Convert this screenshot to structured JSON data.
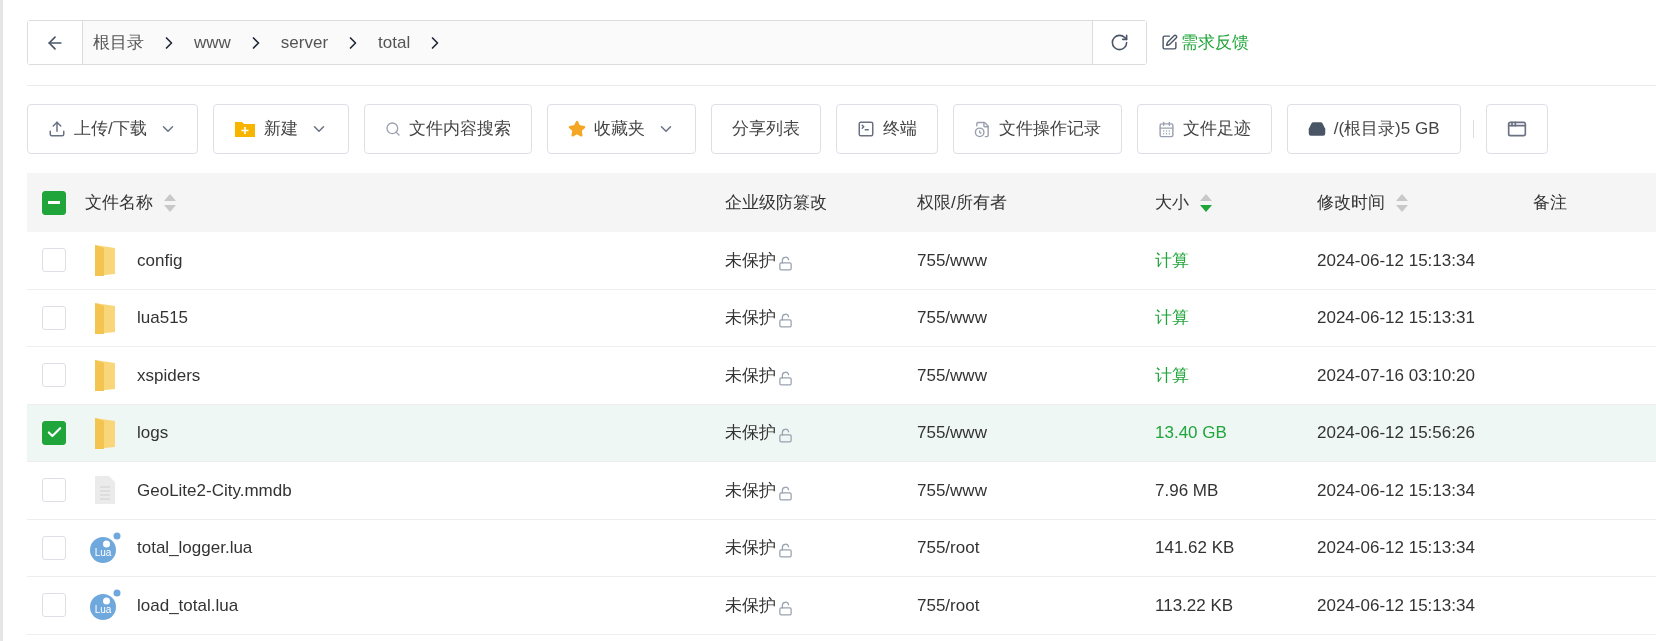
{
  "breadcrumb": {
    "segments": [
      "根目录",
      "www",
      "server",
      "total"
    ]
  },
  "feedback": {
    "label": "需求反馈"
  },
  "toolbar": [
    {
      "label": "上传/下载",
      "kind": "upload",
      "dropdown": true
    },
    {
      "label": "新建",
      "kind": "new",
      "dropdown": true
    },
    {
      "label": "文件内容搜索",
      "kind": "search",
      "dropdown": false
    },
    {
      "label": "收藏夹",
      "kind": "favorites",
      "dropdown": true
    },
    {
      "label": "分享列表",
      "kind": "share",
      "dropdown": false
    },
    {
      "label": "终端",
      "kind": "terminal",
      "dropdown": false
    },
    {
      "label": "文件操作记录",
      "kind": "log",
      "dropdown": false
    },
    {
      "label": "文件足迹",
      "kind": "history",
      "dropdown": false
    },
    {
      "label": "/(根目录)5 GB",
      "kind": "disk",
      "dropdown": false
    },
    {
      "kind": "protect",
      "dropdown": false
    }
  ],
  "table": {
    "select_all": {
      "indeterminate": true
    },
    "columns": [
      {
        "label": "文件名称",
        "sortable": true,
        "sort_desc": false
      },
      {
        "label": "企业级防篡改",
        "sortable": false
      },
      {
        "label": "权限/所有者",
        "sortable": false
      },
      {
        "label": "大小",
        "sortable": true,
        "sort_desc": true
      },
      {
        "label": "修改时间",
        "sortable": true,
        "sort_desc": false
      },
      {
        "label": "备注",
        "sortable": false
      }
    ],
    "rows": [
      {
        "selected": false,
        "kind": "folder",
        "name": "config",
        "protection": "未保护",
        "permission": "755/www",
        "size": "计算",
        "size_highlighted": true,
        "modified": "2024-06-12 15:13:34"
      },
      {
        "selected": false,
        "kind": "folder",
        "name": "lua515",
        "protection": "未保护",
        "permission": "755/www",
        "size": "计算",
        "size_highlighted": true,
        "modified": "2024-06-12 15:13:31"
      },
      {
        "selected": false,
        "kind": "folder",
        "name": "xspiders",
        "protection": "未保护",
        "permission": "755/www",
        "size": "计算",
        "size_highlighted": true,
        "modified": "2024-07-16 03:10:20"
      },
      {
        "selected": true,
        "kind": "folder",
        "name": "logs",
        "protection": "未保护",
        "permission": "755/www",
        "size": "13.40 GB",
        "size_highlighted": true,
        "modified": "2024-06-12 15:56:26"
      },
      {
        "selected": false,
        "kind": "file",
        "name": "GeoLite2-City.mmdb",
        "protection": "未保护",
        "permission": "755/www",
        "size": "7.96 MB",
        "size_highlighted": false,
        "modified": "2024-06-12 15:13:34"
      },
      {
        "selected": false,
        "kind": "lua",
        "icon_text": "Lua",
        "name": "total_logger.lua",
        "protection": "未保护",
        "permission": "755/root",
        "size": "141.62 KB",
        "size_highlighted": false,
        "modified": "2024-06-12 15:13:34"
      },
      {
        "selected": false,
        "kind": "lua",
        "icon_text": "Lua",
        "name": "load_total.lua",
        "protection": "未保护",
        "permission": "755/root",
        "size": "113.22 KB",
        "size_highlighted": false,
        "modified": "2024-06-12 15:13:34"
      }
    ]
  }
}
